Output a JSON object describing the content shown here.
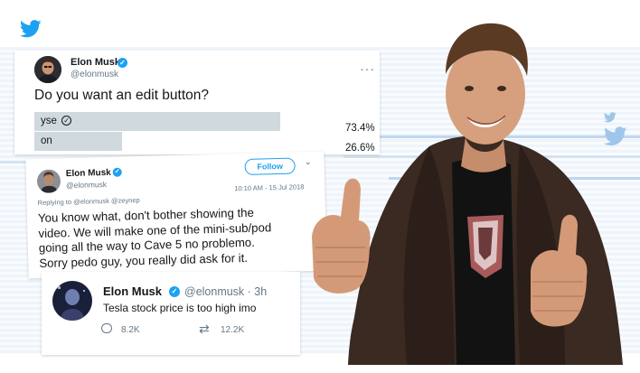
{
  "poll_tweet": {
    "name": "Elon Musk",
    "handle": "@elonmusk",
    "question": "Do you want an edit button?",
    "options": [
      {
        "label": "yse",
        "percent": "73.4%",
        "fraction": 0.734
      },
      {
        "label": "on",
        "percent": "26.6%",
        "fraction": 0.266
      }
    ],
    "more_icon": "more-dots-icon"
  },
  "reply_tweet": {
    "name": "Elon Musk",
    "handle": "@elonmusk",
    "follow_label": "Follow",
    "timestamp": "10:10 AM - 15 Jul 2018",
    "replying_to": "Replying to @elonmusk @zeynep",
    "text_lines": [
      "You know what, don't bother showing the",
      "video. We will make one of the mini-sub/pod",
      "going all the way to Cave 5 no problemo.",
      "Sorry pedo guy, you really did ask for it."
    ]
  },
  "stock_tweet": {
    "name": "Elon Musk",
    "handle": "@elonmusk",
    "age": "· 3h",
    "text": "Tesla stock price is too high imo",
    "replies": "8.2K",
    "retweets": "12.2K"
  },
  "colors": {
    "twitter_blue": "#1da1f2",
    "text_dark": "#14171a",
    "text_gray": "#657786",
    "poll_bar": "#cfd9de"
  }
}
